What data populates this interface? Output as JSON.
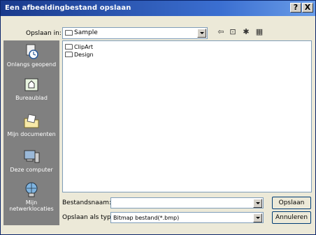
{
  "window": {
    "title": "Een afbeeldingbestand opslaan"
  },
  "titlebar_buttons": {
    "help_label": "?",
    "close_label": "X"
  },
  "save_in": {
    "label": "Opslaan in:",
    "value": "Sample"
  },
  "places": [
    {
      "label": "Onlangs geopend",
      "icon": "recent-documents-icon"
    },
    {
      "label": "Bureaublad",
      "icon": "desktop-icon"
    },
    {
      "label": "Mijn documenten",
      "icon": "my-documents-icon"
    },
    {
      "label": "Deze computer",
      "icon": "my-computer-icon"
    },
    {
      "label": "Mijn netwerklocaties",
      "icon": "network-places-icon"
    }
  ],
  "files": [
    {
      "name": "ClipArt",
      "icon": "folder-icon"
    },
    {
      "name": "Design",
      "icon": "folder-icon"
    }
  ],
  "filename": {
    "label": "Bestandsnaam:",
    "value": ""
  },
  "filetype": {
    "label": "Opslaan als type:",
    "value": "Bitmap bestand(*.bmp)"
  },
  "buttons": {
    "save": "Opslaan",
    "cancel": "Annuleren"
  },
  "colors": {
    "title_bar": "#1a3a8c",
    "dialog_bg": "#ece9d8",
    "places_bar": "#808080"
  }
}
